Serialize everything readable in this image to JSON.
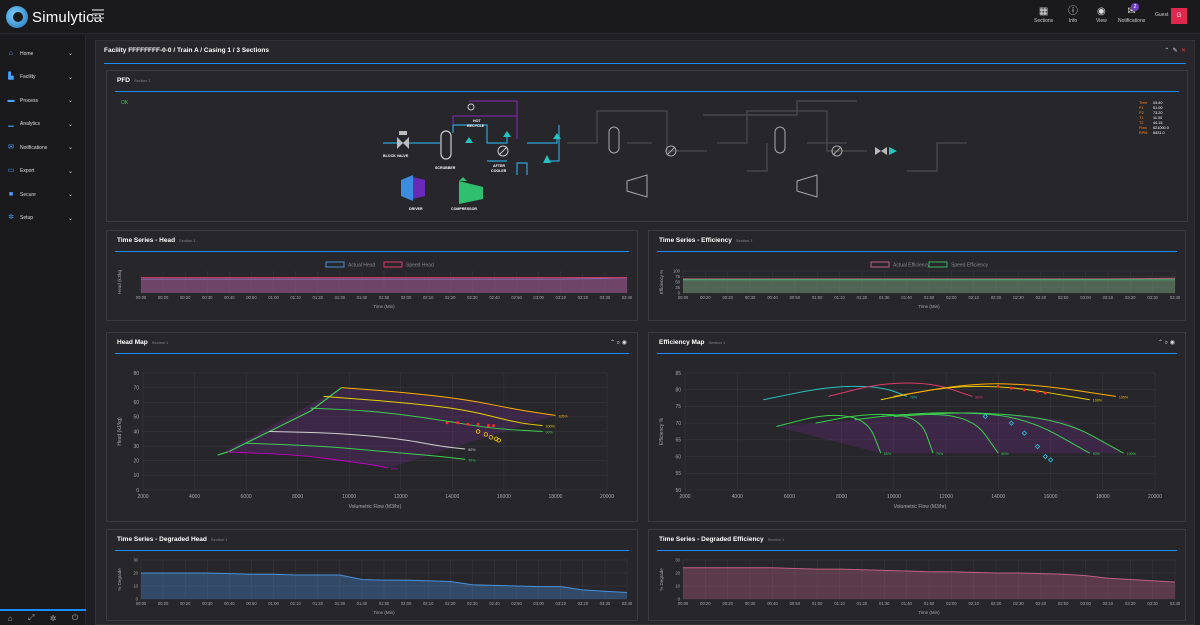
{
  "app": {
    "name": "Simulytica"
  },
  "topbar": {
    "items": [
      {
        "label": "Sections",
        "icon": "grid-icon"
      },
      {
        "label": "Info",
        "icon": "info-icon"
      },
      {
        "label": "View",
        "icon": "eye-icon"
      },
      {
        "label": "Notifications",
        "icon": "envelope-icon",
        "badge": "2"
      }
    ],
    "user": "Guest",
    "avatar": "G"
  },
  "sidebar": {
    "items": [
      {
        "label": "Home",
        "icon": "home-icon"
      },
      {
        "label": "Facility",
        "icon": "facility-icon"
      },
      {
        "label": "Process",
        "icon": "process-icon"
      },
      {
        "label": "Analytics",
        "icon": "chart-icon"
      },
      {
        "label": "Notifications",
        "icon": "bell-icon"
      },
      {
        "label": "Export",
        "icon": "export-icon"
      },
      {
        "label": "Secure",
        "icon": "lock-icon"
      },
      {
        "label": "Setup",
        "icon": "gear-icon"
      }
    ]
  },
  "main": {
    "title": "Facility FFFFFFFF-0-0 / Train A / Casing 1 / 3 Sections"
  },
  "pfd": {
    "title": "PFD",
    "sub": "Section 1",
    "status": "OK",
    "labels": {
      "block_valve": "BLOCK VALVE",
      "scrubber": "SCRUBBER",
      "hot_recycle_1": "HOT",
      "hot_recycle_2": "RECYCLE",
      "after_cooler_1": "AFTER",
      "after_cooler_2": "COOLER",
      "driver": "DRIVER",
      "compressor": "COMPRESSOR"
    },
    "readout": [
      {
        "k": "Time",
        "v": "03:40"
      },
      {
        "k": "P1",
        "v": "51.00"
      },
      {
        "k": "P2",
        "v": "73.20"
      },
      {
        "k": "T1",
        "v": "11.00"
      },
      {
        "k": "T2",
        "v": "44.15"
      },
      {
        "k": "Flow",
        "v": "621000.0"
      },
      {
        "k": "RPM",
        "v": "8431.0"
      }
    ]
  },
  "ts_head": {
    "title": "Time Series - Head",
    "sub": "Section 1",
    "legend": [
      "Actual Head",
      "Speed Head"
    ],
    "ylabel": "Head (kJ/kg",
    "xlabel": "Time (Min)"
  },
  "ts_eff": {
    "title": "Time Series - Efficiency",
    "sub": "Section 1",
    "legend": [
      "Actual Efficiency",
      "Speed Efficiency"
    ],
    "ylabel": "Efficiency %",
    "xlabel": "Time (Min)",
    "yticks": [
      "100",
      "75",
      "50",
      "25",
      "0"
    ]
  },
  "head_map": {
    "title": "Head Map",
    "sub": "Section 1",
    "ylabel": "Head (kJ/kg)",
    "xlabel": "Volumetric Flow (M3/hr)",
    "speed_labels": [
      "85%",
      "100%",
      "105%",
      "90%",
      "80%",
      "70%",
      "60%"
    ]
  },
  "eff_map": {
    "title": "Efficiency Map",
    "sub": "Section 1",
    "ylabel": "Efficiency %",
    "xlabel": "Volumetric Flow (M3/hr)",
    "speed_labels": [
      "70%",
      "80%",
      "100%",
      "105%",
      "60%",
      "70%",
      "80%",
      "90%",
      "100%"
    ]
  },
  "ts_dhead": {
    "title": "Time Series - Degraded Head",
    "sub": "Section 1",
    "ylabel": "% Degrade",
    "xlabel": "Time (Min)"
  },
  "ts_deff": {
    "title": "Time Series - Degraded Efficiency",
    "sub": "Section 1",
    "ylabel": "% Degrade",
    "xlabel": "Time (Min)"
  },
  "time_ticks": [
    "00:00",
    "00:20",
    "00:20",
    "00:30",
    "00:40",
    "00:50",
    "01:00",
    "01:10",
    "01:20",
    "01:30",
    "01:40",
    "01:50",
    "02:00",
    "02:10",
    "02:20",
    "02:30",
    "02:40",
    "02:50",
    "03:00",
    "03:10",
    "03:20",
    "03:30",
    "03:40"
  ],
  "chart_data": [
    {
      "type": "line",
      "title": "Time Series - Head",
      "xlabel": "Time (Min)",
      "ylabel": "Head (kJ/kg",
      "series": [
        {
          "name": "Actual Head",
          "color": "#4a90d9",
          "values": [
            38,
            38,
            38,
            38,
            38,
            38,
            38,
            38,
            38,
            38,
            38,
            38,
            38,
            38,
            38,
            38,
            38,
            38,
            38,
            38,
            39,
            40,
            42
          ]
        },
        {
          "name": "Speed Head",
          "color": "#e03a6a",
          "values": [
            42,
            42,
            42,
            42,
            42,
            42,
            42,
            42,
            42,
            42,
            42,
            42,
            42,
            42,
            42,
            42,
            42,
            42,
            42,
            42,
            42,
            42,
            42
          ]
        }
      ]
    },
    {
      "type": "line",
      "title": "Time Series - Efficiency",
      "xlabel": "Time (Min)",
      "ylabel": "Efficiency %",
      "ylim": [
        0,
        100
      ],
      "series": [
        {
          "name": "Actual Efficiency",
          "color": "#c06080",
          "values": [
            64,
            64,
            64,
            64,
            64,
            64,
            64,
            64,
            64,
            64,
            64,
            64,
            64,
            64,
            64,
            64,
            64,
            64,
            64,
            64,
            65,
            66,
            67
          ]
        },
        {
          "name": "Speed Efficiency",
          "color": "#3bb56a",
          "values": [
            60,
            60,
            60,
            60,
            60,
            60,
            60,
            60,
            60,
            60,
            60,
            60,
            60,
            60,
            60,
            60,
            60,
            60,
            60,
            60,
            60,
            60,
            60
          ]
        }
      ]
    },
    {
      "type": "scatter",
      "title": "Head Map",
      "xlabel": "Volumetric Flow (M3/hr)",
      "ylabel": "Head (kJ/kg)",
      "xlim": [
        2000,
        20000
      ],
      "ylim": [
        0,
        80
      ],
      "xticks": [
        2000,
        4000,
        6000,
        8000,
        10000,
        12000,
        14000,
        16000,
        18000,
        20000
      ],
      "yticks": [
        0,
        10,
        20,
        30,
        40,
        50,
        60,
        70,
        80
      ],
      "surge_line": [
        [
          4900,
          24
        ],
        [
          5300,
          26
        ],
        [
          6900,
          40
        ],
        [
          8500,
          54
        ],
        [
          9700,
          70
        ]
      ],
      "curves": [
        {
          "label": "105%",
          "color": "#ffb000",
          "points": [
            [
              9700,
              70
            ],
            [
              12000,
              67
            ],
            [
              14500,
              62
            ],
            [
              16500,
              55
            ],
            [
              18000,
              51
            ]
          ]
        },
        {
          "label": "100%",
          "color": "#e8d000",
          "points": [
            [
              9000,
              64
            ],
            [
              12000,
              60
            ],
            [
              14500,
              55
            ],
            [
              16500,
              46
            ],
            [
              17500,
              44
            ]
          ]
        },
        {
          "label": "90%",
          "color": "#3bd050",
          "points": [
            [
              8500,
              56
            ],
            [
              11000,
              54
            ],
            [
              13500,
              48
            ],
            [
              15500,
              42
            ],
            [
              17500,
              40
            ]
          ]
        },
        {
          "label": "80%",
          "color": "#d0d0d0",
          "points": [
            [
              6900,
              40
            ],
            [
              9500,
              39
            ],
            [
              12000,
              35
            ],
            [
              13500,
              30
            ],
            [
              14500,
              28
            ]
          ]
        },
        {
          "label": "70%",
          "color": "#3bd050",
          "points": [
            [
              6000,
              32
            ],
            [
              9000,
              30
            ],
            [
              11500,
              26
            ],
            [
              13500,
              23
            ],
            [
              14500,
              21
            ]
          ]
        },
        {
          "label": "60%",
          "color": "#c000c0",
          "points": [
            [
              5300,
              26
            ],
            [
              8000,
              24
            ],
            [
              9800,
              20
            ],
            [
              11000,
              17
            ],
            [
              11500,
              15
            ]
          ]
        }
      ],
      "points_red": [
        [
          13800,
          46
        ],
        [
          14200,
          46
        ],
        [
          14600,
          45
        ],
        [
          15000,
          45
        ],
        [
          15400,
          44
        ],
        [
          15600,
          44
        ]
      ],
      "points_yellow": [
        [
          15000,
          40
        ],
        [
          15300,
          38
        ],
        [
          15500,
          36
        ],
        [
          15700,
          35
        ],
        [
          15800,
          34
        ]
      ]
    },
    {
      "type": "scatter",
      "title": "Efficiency Map",
      "xlabel": "Volumetric Flow (M3/hr)",
      "ylabel": "Efficiency %",
      "xlim": [
        2000,
        20000
      ],
      "ylim": [
        50,
        85
      ],
      "xticks": [
        2000,
        4000,
        6000,
        8000,
        10000,
        12000,
        14000,
        16000,
        18000,
        20000
      ],
      "yticks": [
        50,
        55,
        60,
        65,
        70,
        75,
        80,
        85
      ],
      "curves": [
        {
          "label": "70%",
          "color": "#27c3c0",
          "points": [
            [
              5000,
              77
            ],
            [
              7500,
              81
            ],
            [
              9500,
              81
            ],
            [
              10500,
              78
            ]
          ]
        },
        {
          "label": "80%",
          "color": "#e03a6a",
          "points": [
            [
              7500,
              78
            ],
            [
              9500,
              82
            ],
            [
              11500,
              82
            ],
            [
              13000,
              78
            ]
          ]
        },
        {
          "label": "100%",
          "color": "#e8d000",
          "points": [
            [
              9500,
              77
            ],
            [
              12000,
              81
            ],
            [
              14500,
              81
            ],
            [
              17500,
              77
            ]
          ]
        },
        {
          "label": "105%",
          "color": "#ffb000",
          "points": [
            [
              10000,
              78
            ],
            [
              13000,
              82
            ],
            [
              15500,
              81.5
            ],
            [
              18500,
              78
            ]
          ]
        },
        {
          "label": "60%",
          "color": "#3bd050",
          "points": [
            [
              5500,
              69
            ],
            [
              7500,
              73
            ],
            [
              9000,
              71
            ],
            [
              9500,
              61
            ]
          ]
        },
        {
          "label": "70%",
          "color": "#3bd050",
          "points": [
            [
              7000,
              70
            ],
            [
              9000,
              73
            ],
            [
              11000,
              72
            ],
            [
              11500,
              61
            ]
          ]
        },
        {
          "label": "80%",
          "color": "#3bd050",
          "points": [
            [
              8500,
              71
            ],
            [
              10500,
              73
            ],
            [
              13000,
              72
            ],
            [
              14000,
              61
            ]
          ]
        },
        {
          "label": "90%",
          "color": "#3bd050",
          "points": [
            [
              9500,
              72
            ],
            [
              12000,
              73.5
            ],
            [
              15000,
              72
            ],
            [
              17500,
              61
            ]
          ]
        },
        {
          "label": "100%",
          "color": "#3bd050",
          "points": [
            [
              10000,
              72
            ],
            [
              13000,
              73.5
            ],
            [
              16500,
              71
            ],
            [
              18800,
              61
            ]
          ]
        }
      ],
      "points_red": [
        [
          14000,
          81
        ],
        [
          14500,
          80.5
        ],
        [
          15000,
          80
        ],
        [
          15500,
          79.5
        ],
        [
          15800,
          79
        ]
      ],
      "points_cyan": [
        [
          13500,
          72
        ],
        [
          14500,
          70
        ],
        [
          15000,
          67
        ],
        [
          15500,
          63
        ],
        [
          15800,
          60
        ],
        [
          16000,
          59
        ]
      ]
    },
    {
      "type": "area",
      "title": "Time Series - Degraded Head",
      "xlabel": "Time (Min)",
      "ylabel": "% Degrade",
      "ylim": [
        0,
        30
      ],
      "yticks": [
        0,
        10,
        20,
        30
      ],
      "series": [
        {
          "name": "",
          "color": "#4a90d9",
          "values": [
            20,
            20,
            20,
            20,
            19.5,
            19,
            19,
            18.5,
            18.5,
            18.5,
            15,
            14.5,
            14.5,
            14,
            13.5,
            11,
            10.5,
            10,
            9.5,
            9.5,
            7,
            6,
            5
          ]
        }
      ]
    },
    {
      "type": "area",
      "title": "Time Series - Degraded Efficiency",
      "xlabel": "Time (Min)",
      "ylabel": "% Degrade",
      "ylim": [
        0,
        30
      ],
      "yticks": [
        0,
        10,
        20,
        30
      ],
      "series": [
        {
          "name": "",
          "color": "#c06080",
          "values": [
            24,
            24,
            24,
            24,
            24,
            23.5,
            23,
            23,
            22.5,
            22,
            21.5,
            21,
            21,
            20.5,
            20,
            20,
            19.5,
            19,
            18,
            16,
            15,
            14,
            13
          ]
        }
      ]
    }
  ]
}
